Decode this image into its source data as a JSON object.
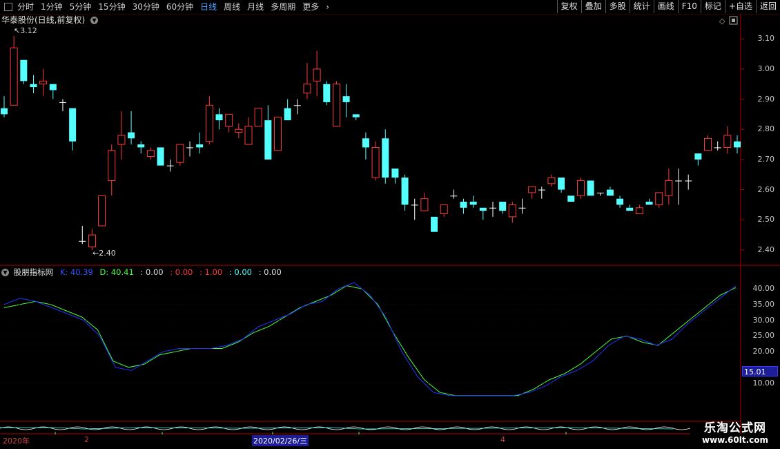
{
  "toolbar": {
    "periods": [
      "分时",
      "1分钟",
      "5分钟",
      "15分钟",
      "30分钟",
      "60分钟",
      "日线",
      "周线",
      "月线",
      "多周期",
      "更多"
    ],
    "active_period": "日线",
    "buttons": [
      "复权",
      "叠加",
      "多股",
      "统计",
      "画线",
      "F10",
      "标记",
      "+自选",
      "返回"
    ]
  },
  "main_chart": {
    "title": "华泰股份(日线,前复权)",
    "high_marker": "3.12",
    "low_marker": "2.40",
    "y_ticks": [
      "3.10",
      "3.00",
      "2.90",
      "2.80",
      "2.70",
      "2.60",
      "2.50",
      "2.40"
    ]
  },
  "indicator": {
    "name": "股朋指标网",
    "k_label": "K: 40.39",
    "d_label": "D: 40.41",
    "v1": ": 0.00",
    "v2": ": 0.00",
    "v3": ": 1.00",
    "v4": ": 0.00",
    "v5": ": 0.00",
    "y_ticks": [
      "40.00",
      "35.00",
      "30.00",
      "25.00",
      "20.00",
      "10.00"
    ],
    "live_value": "15.01"
  },
  "date_axis": {
    "labels": [
      "2020年",
      "2",
      "2020/02/26/三",
      "4"
    ]
  },
  "watermark": {
    "line1": "乐淘公式网",
    "line2": "www.60lt.com"
  },
  "colors": {
    "up": "#ff3b3b",
    "down": "#54ffff",
    "k_line": "#2233ff",
    "d_line": "#44ff44",
    "axis": "#b00000"
  },
  "chart_data": {
    "type": "candlestick",
    "price_ylim": [
      2.37,
      3.16
    ],
    "candles": [
      [
        2.87,
        2.91,
        2.84,
        2.85
      ],
      [
        2.88,
        3.11,
        2.88,
        3.07
      ],
      [
        3.03,
        3.03,
        2.95,
        2.96
      ],
      [
        2.95,
        2.98,
        2.92,
        2.94
      ],
      [
        2.95,
        3.0,
        2.91,
        2.96
      ],
      [
        2.95,
        2.95,
        2.9,
        2.93
      ],
      [
        2.89,
        2.9,
        2.86,
        2.89
      ],
      [
        2.87,
        2.87,
        2.73,
        2.76
      ],
      [
        2.43,
        2.48,
        2.42,
        2.43
      ],
      [
        2.41,
        2.47,
        2.4,
        2.45
      ],
      [
        2.48,
        2.58,
        2.48,
        2.58
      ],
      [
        2.63,
        2.75,
        2.58,
        2.73
      ],
      [
        2.75,
        2.86,
        2.7,
        2.78
      ],
      [
        2.79,
        2.86,
        2.75,
        2.77
      ],
      [
        2.75,
        2.76,
        2.72,
        2.74
      ],
      [
        2.71,
        2.74,
        2.7,
        2.73
      ],
      [
        2.74,
        2.74,
        2.7,
        2.68
      ],
      [
        2.68,
        2.7,
        2.66,
        2.68
      ],
      [
        2.69,
        2.75,
        2.68,
        2.75
      ],
      [
        2.74,
        2.76,
        2.71,
        2.74
      ],
      [
        2.75,
        2.79,
        2.72,
        2.74
      ],
      [
        2.76,
        2.91,
        2.75,
        2.88
      ],
      [
        2.85,
        2.87,
        2.8,
        2.83
      ],
      [
        2.81,
        2.85,
        2.79,
        2.85
      ],
      [
        2.79,
        2.82,
        2.77,
        2.8
      ],
      [
        2.75,
        2.84,
        2.75,
        2.81
      ],
      [
        2.81,
        2.87,
        2.81,
        2.87
      ],
      [
        2.83,
        2.88,
        2.7,
        2.7
      ],
      [
        2.73,
        2.84,
        2.73,
        2.84
      ],
      [
        2.87,
        2.9,
        2.83,
        2.83
      ],
      [
        2.88,
        2.9,
        2.85,
        2.88
      ],
      [
        2.92,
        3.02,
        2.9,
        2.95
      ],
      [
        2.96,
        3.06,
        2.91,
        3.0
      ],
      [
        2.95,
        2.96,
        2.88,
        2.89
      ],
      [
        2.81,
        2.96,
        2.81,
        2.95
      ],
      [
        2.91,
        2.95,
        2.84,
        2.89
      ],
      [
        2.85,
        2.85,
        2.83,
        2.84
      ],
      [
        2.77,
        2.79,
        2.7,
        2.74
      ],
      [
        2.64,
        2.76,
        2.63,
        2.74
      ],
      [
        2.77,
        2.8,
        2.62,
        2.64
      ],
      [
        2.67,
        2.67,
        2.62,
        2.64
      ],
      [
        2.64,
        2.65,
        2.53,
        2.55
      ],
      [
        2.55,
        2.57,
        2.5,
        2.55
      ],
      [
        2.53,
        2.59,
        2.53,
        2.57
      ],
      [
        2.51,
        2.51,
        2.46,
        2.46
      ],
      [
        2.52,
        2.55,
        2.51,
        2.55
      ],
      [
        2.58,
        2.6,
        2.57,
        2.58
      ],
      [
        2.56,
        2.57,
        2.52,
        2.54
      ],
      [
        2.56,
        2.58,
        2.54,
        2.55
      ],
      [
        2.54,
        2.54,
        2.5,
        2.53
      ],
      [
        2.54,
        2.56,
        2.51,
        2.54
      ],
      [
        2.56,
        2.56,
        2.52,
        2.53
      ],
      [
        2.51,
        2.56,
        2.49,
        2.55
      ],
      [
        2.54,
        2.57,
        2.52,
        2.54
      ],
      [
        2.59,
        2.61,
        2.57,
        2.61
      ],
      [
        2.6,
        2.61,
        2.57,
        2.6
      ],
      [
        2.62,
        2.65,
        2.61,
        2.64
      ],
      [
        2.64,
        2.64,
        2.59,
        2.6
      ],
      [
        2.58,
        2.58,
        2.56,
        2.56
      ],
      [
        2.58,
        2.64,
        2.57,
        2.63
      ],
      [
        2.63,
        2.63,
        2.59,
        2.58
      ],
      [
        2.59,
        2.59,
        2.58,
        2.59
      ],
      [
        2.6,
        2.61,
        2.58,
        2.58
      ],
      [
        2.57,
        2.58,
        2.54,
        2.55
      ],
      [
        2.54,
        2.55,
        2.53,
        2.53
      ],
      [
        2.52,
        2.55,
        2.52,
        2.54
      ],
      [
        2.56,
        2.57,
        2.55,
        2.55
      ],
      [
        2.55,
        2.59,
        2.54,
        2.59
      ],
      [
        2.58,
        2.67,
        2.55,
        2.63
      ],
      [
        2.63,
        2.67,
        2.55,
        2.63
      ],
      [
        2.63,
        2.65,
        2.6,
        2.63
      ],
      [
        2.72,
        2.72,
        2.68,
        2.7
      ],
      [
        2.73,
        2.78,
        2.73,
        2.77
      ],
      [
        2.74,
        2.76,
        2.73,
        2.74
      ],
      [
        2.74,
        2.81,
        2.72,
        2.78
      ],
      [
        2.76,
        2.78,
        2.72,
        2.74
      ]
    ],
    "kd_ylim": [
      0,
      44
    ],
    "k_values": [
      35,
      37,
      36,
      34,
      32,
      30,
      25,
      15,
      14,
      17,
      20,
      21,
      21,
      21,
      22,
      24,
      28,
      30,
      32,
      35,
      36,
      40,
      42,
      38,
      31,
      20,
      12,
      7,
      6,
      6,
      6,
      6,
      6,
      7,
      9,
      12,
      14,
      17,
      22,
      25,
      24,
      22,
      24,
      29,
      33,
      37,
      41
    ],
    "d_values": [
      34,
      35,
      36,
      35,
      33,
      31,
      27,
      17,
      15,
      16,
      19,
      20,
      21,
      21,
      21,
      23,
      26,
      28,
      31,
      34,
      36,
      38,
      41,
      40,
      35,
      26,
      18,
      11,
      7,
      6,
      6,
      6,
      6,
      6,
      8,
      11,
      13,
      16,
      20,
      24,
      25,
      23,
      22,
      26,
      30,
      34,
      38,
      40.4
    ]
  }
}
